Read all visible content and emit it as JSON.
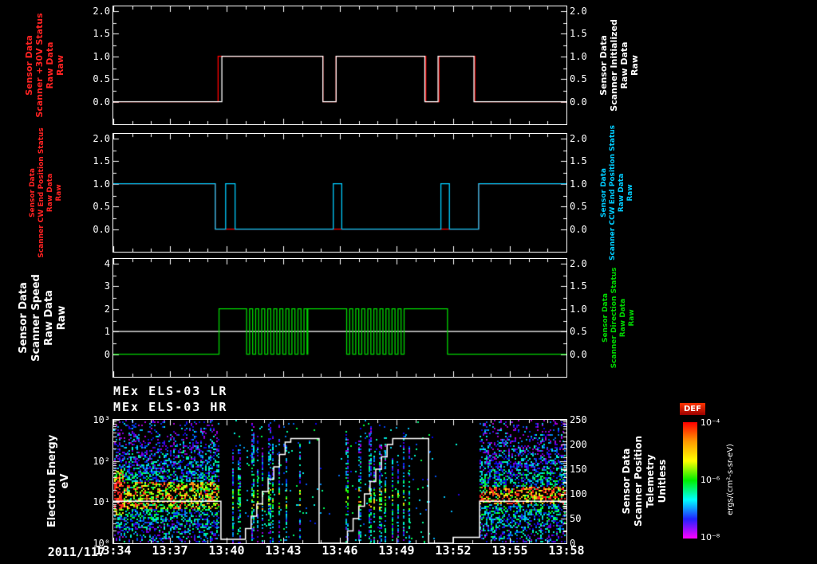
{
  "meta": {
    "background": "#000000",
    "tick_color": "#ffffff"
  },
  "xaxis": {
    "date": "2011/117",
    "range_minutes": [
      0,
      24
    ],
    "start_time": "13:34",
    "end_time": "13:58",
    "ticks": [
      {
        "t": 0,
        "label": "13:34"
      },
      {
        "t": 3,
        "label": "13:37"
      },
      {
        "t": 6,
        "label": "13:40"
      },
      {
        "t": 9,
        "label": "13:43"
      },
      {
        "t": 12,
        "label": "13:46"
      },
      {
        "t": 15,
        "label": "13:49"
      },
      {
        "t": 18,
        "label": "13:52"
      },
      {
        "t": 21,
        "label": "13:55"
      },
      {
        "t": 24,
        "label": "13:58"
      }
    ]
  },
  "chart_data": [
    {
      "id": "scanner-30v-panel",
      "type": "line",
      "ylim": [
        -0.5,
        2.1
      ],
      "ylim_right": [
        -0.5,
        2.1
      ],
      "yticks": {
        "values": [
          2.0,
          1.5,
          1.0,
          0.5,
          0.0
        ],
        "labels": [
          "2.0",
          "1.5",
          "1.0",
          "0.5",
          "0.0"
        ]
      },
      "yticks_right": {
        "values": [
          2.0,
          1.5,
          1.0,
          0.5,
          0.0
        ],
        "labels": [
          "2.0",
          "1.5",
          "1.0",
          "0.5",
          "0.0"
        ]
      },
      "label_left": {
        "color": "#ff2222",
        "lines": [
          "Sensor Data",
          "Scanner +30V Status",
          "Raw Data",
          "Raw"
        ]
      },
      "label_right": {
        "color": "#ffffff",
        "lines": [
          "Sensor Data",
          "Scanner Initialized",
          "Raw Data",
          "Raw"
        ]
      },
      "series": [
        {
          "name": "Scanner +30V Status",
          "color": "#ff0000",
          "axis": "left",
          "points": [
            [
              0,
              0
            ],
            [
              5.55,
              0
            ],
            [
              5.55,
              1
            ],
            [
              11.1,
              1
            ],
            [
              11.1,
              0
            ],
            [
              11.8,
              0
            ],
            [
              11.8,
              1
            ],
            [
              16.55,
              1
            ],
            [
              16.55,
              0
            ],
            [
              17.25,
              0
            ],
            [
              17.25,
              1
            ],
            [
              19.15,
              1
            ],
            [
              19.15,
              0
            ],
            [
              24,
              0
            ]
          ]
        },
        {
          "name": "Scanner Initialized",
          "color": "#ffffff",
          "axis": "left",
          "points": [
            [
              0,
              0
            ],
            [
              5.75,
              0
            ],
            [
              5.75,
              1
            ],
            [
              11.1,
              1
            ],
            [
              11.1,
              0
            ],
            [
              11.8,
              0
            ],
            [
              11.8,
              1
            ],
            [
              16.5,
              1
            ],
            [
              16.5,
              0
            ],
            [
              17.2,
              0
            ],
            [
              17.2,
              1
            ],
            [
              19.1,
              1
            ],
            [
              19.1,
              0
            ],
            [
              24,
              0
            ]
          ]
        }
      ]
    },
    {
      "id": "end-position-panel",
      "type": "line",
      "ylim": [
        -0.5,
        2.1
      ],
      "ylim_right": [
        -0.5,
        2.1
      ],
      "yticks": {
        "values": [
          2.0,
          1.5,
          1.0,
          0.5,
          0.0
        ],
        "labels": [
          "2.0",
          "1.5",
          "1.0",
          "0.5",
          "0.0"
        ]
      },
      "yticks_right": {
        "values": [
          2.0,
          1.5,
          1.0,
          0.5,
          0.0
        ],
        "labels": [
          "2.0",
          "1.5",
          "1.0",
          "0.5",
          "0.0"
        ]
      },
      "label_left": {
        "color": "#ff2222",
        "lines": [
          "Sensor Data",
          "Scanner CW End Position Status",
          "Raw Data",
          "Raw"
        ]
      },
      "label_right": {
        "color": "#00ccff",
        "lines": [
          "Sensor Data",
          "Scanner CCW End Position Status",
          "Raw Data",
          "Raw"
        ]
      },
      "series": [
        {
          "name": "Scanner CW End Position Status",
          "color": "#ff0000",
          "axis": "left",
          "points": [
            [
              0,
              1
            ],
            [
              5.4,
              1
            ],
            [
              5.4,
              0
            ],
            [
              19.35,
              0
            ],
            [
              19.35,
              1
            ],
            [
              24,
              1
            ]
          ]
        },
        {
          "name": "Scanner CCW End Position Status",
          "color": "#00ccff",
          "axis": "left",
          "points": [
            [
              0,
              1
            ],
            [
              5.4,
              1
            ],
            [
              5.4,
              0
            ],
            [
              5.95,
              0
            ],
            [
              5.95,
              1
            ],
            [
              6.45,
              1
            ],
            [
              6.45,
              0
            ],
            [
              11.65,
              0
            ],
            [
              11.65,
              1
            ],
            [
              12.1,
              1
            ],
            [
              12.1,
              0
            ],
            [
              17.35,
              0
            ],
            [
              17.35,
              1
            ],
            [
              17.8,
              1
            ],
            [
              17.8,
              0
            ],
            [
              19.35,
              0
            ],
            [
              19.35,
              1
            ],
            [
              24,
              1
            ]
          ]
        }
      ]
    },
    {
      "id": "scanner-speed-panel",
      "type": "line",
      "ylim": [
        -1.0,
        4.2
      ],
      "ylim_right": [
        -0.5,
        2.1
      ],
      "yticks": {
        "values": [
          4,
          3,
          2,
          1,
          0
        ],
        "labels": [
          "4",
          "3",
          "2",
          "1",
          "0"
        ]
      },
      "yticks_right": {
        "values": [
          2.0,
          1.5,
          1.0,
          0.5,
          0.0
        ],
        "labels": [
          "2.0",
          "1.5",
          "1.0",
          "0.5",
          "0.0"
        ]
      },
      "label_left": {
        "color": "#ffffff",
        "lines": [
          "Sensor Data",
          "Scanner Speed",
          "Raw Data",
          "Raw"
        ]
      },
      "label_right": {
        "color": "#00d800",
        "lines": [
          "Sensor Data",
          "Scanner Direction Status",
          "Raw Data",
          "Raw"
        ]
      },
      "series": [
        {
          "name": "Scanner Speed",
          "color": "#ffffff",
          "axis": "left",
          "points": [
            [
              0,
              1
            ],
            [
              24,
              1
            ]
          ]
        },
        {
          "name": "Scanner Direction Status",
          "color": "#00d800",
          "axis": "right",
          "segments": [
            {
              "t0": 0,
              "t1": 5.6,
              "v": 0
            },
            {
              "t0": 5.6,
              "t1": 6.9,
              "v": 1
            },
            {
              "t0": 6.9,
              "t1": 10.3,
              "osc": 0.32
            },
            {
              "t0": 10.3,
              "t1": 12.2,
              "v": 1
            },
            {
              "t0": 12.2,
              "t1": 15.5,
              "osc": 0.32
            },
            {
              "t0": 15.5,
              "t1": 17.7,
              "v": 1
            },
            {
              "t0": 17.7,
              "t1": 24,
              "v": 0
            }
          ]
        }
      ]
    },
    {
      "id": "els-spectrogram-panel",
      "type": "heatmap",
      "titles": [
        "MEx ELS-03 LR",
        "MEx ELS-03 HR"
      ],
      "y_scale": "log",
      "ylim": [
        1,
        1000
      ],
      "ylim_right": [
        0,
        250
      ],
      "yticks": {
        "values": [
          1000,
          100,
          10,
          1
        ],
        "labels": [
          "10³",
          "10²",
          "10¹",
          "10⁰"
        ]
      },
      "yticks_right": {
        "values": [
          250,
          200,
          150,
          100,
          50,
          0
        ],
        "labels": [
          "250",
          "200",
          "150",
          "100",
          "50",
          "0"
        ]
      },
      "label_left": {
        "color": "#ffffff",
        "lines": [
          "Electron Energy",
          "eV"
        ]
      },
      "label_right": {
        "color": "#ffffff",
        "lines": [
          "Sensor Data",
          "Scanner Position",
          "Telemetry",
          "Unitless"
        ]
      },
      "colorbar": {
        "title": "DEF",
        "ticks": [
          "10⁻⁴",
          "10⁻⁶",
          "10⁻⁸"
        ],
        "unit": "ergs/(cm²-s-sr-eV)",
        "colors": [
          "#ff0000",
          "#ff9900",
          "#ffff00",
          "#00ee00",
          "#00ffff",
          "#2222ff",
          "#ff00ff"
        ]
      },
      "blocks": [
        {
          "t0": 0.05,
          "t1": 5.6,
          "style": "dense",
          "seed": 11,
          "band": [
            0.85,
            1.5,
            0.45
          ],
          "edge_hot": true
        },
        {
          "t0": 6.3,
          "t1": 9.9,
          "style": "columns",
          "seed": 22,
          "band": [
            0.85,
            1.35,
            0.3
          ]
        },
        {
          "t0": 12.3,
          "t1": 15.7,
          "style": "columns",
          "seed": 33,
          "band": [
            0.85,
            1.35,
            0.3
          ]
        },
        {
          "t0": 19.4,
          "t1": 23.95,
          "style": "dense",
          "seed": 44,
          "band": [
            0.95,
            1.4,
            0.6
          ]
        }
      ],
      "overlay": {
        "name": "Scanner Position",
        "color": "#ffffff",
        "points": [
          [
            0,
            85
          ],
          [
            5.7,
            85
          ],
          [
            5.7,
            8
          ],
          [
            7.0,
            8
          ],
          [
            7.0,
            30
          ],
          [
            7.3,
            30
          ],
          [
            7.3,
            55
          ],
          [
            7.6,
            55
          ],
          [
            7.6,
            80
          ],
          [
            7.9,
            80
          ],
          [
            7.9,
            105
          ],
          [
            8.2,
            105
          ],
          [
            8.2,
            130
          ],
          [
            8.5,
            130
          ],
          [
            8.5,
            155
          ],
          [
            8.8,
            155
          ],
          [
            8.8,
            180
          ],
          [
            9.1,
            180
          ],
          [
            9.1,
            205
          ],
          [
            9.4,
            205
          ],
          [
            9.4,
            212
          ],
          [
            10.9,
            212
          ],
          [
            10.9,
            0
          ],
          [
            12.4,
            0
          ],
          [
            12.4,
            25
          ],
          [
            12.7,
            25
          ],
          [
            12.7,
            50
          ],
          [
            13.0,
            50
          ],
          [
            13.0,
            75
          ],
          [
            13.3,
            75
          ],
          [
            13.3,
            100
          ],
          [
            13.6,
            100
          ],
          [
            13.6,
            125
          ],
          [
            13.9,
            125
          ],
          [
            13.9,
            150
          ],
          [
            14.2,
            150
          ],
          [
            14.2,
            175
          ],
          [
            14.5,
            175
          ],
          [
            14.5,
            200
          ],
          [
            14.8,
            200
          ],
          [
            14.8,
            212
          ],
          [
            16.7,
            212
          ],
          [
            16.7,
            0
          ],
          [
            18.0,
            0
          ],
          [
            18.0,
            12
          ],
          [
            19.4,
            12
          ],
          [
            19.4,
            85
          ],
          [
            24,
            85
          ]
        ]
      }
    }
  ]
}
